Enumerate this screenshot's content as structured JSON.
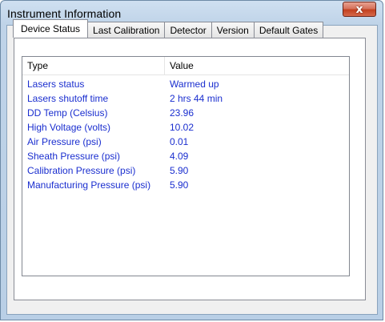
{
  "window": {
    "title": "Instrument Information",
    "close_glyph": "x"
  },
  "tabs": [
    {
      "label": "Device Status",
      "active": true
    },
    {
      "label": "Last Calibration",
      "active": false
    },
    {
      "label": "Detector",
      "active": false
    },
    {
      "label": "Version",
      "active": false
    },
    {
      "label": "Default Gates",
      "active": false
    }
  ],
  "list": {
    "columns": {
      "type": "Type",
      "value": "Value"
    },
    "row_color": "#1a2ecf",
    "rows": [
      {
        "type": "Lasers status",
        "value": "Warmed up"
      },
      {
        "type": "Lasers shutoff time",
        "value": "2 hrs 44 min"
      },
      {
        "type": "DD Temp (Celsius)",
        "value": "23.96"
      },
      {
        "type": "High Voltage (volts)",
        "value": "10.02"
      },
      {
        "type": "Air Pressure (psi)",
        "value": "0.01"
      },
      {
        "type": "Sheath Pressure (psi)",
        "value": "4.09"
      },
      {
        "type": "Calibration Pressure (psi)",
        "value": "5.90"
      },
      {
        "type": "Manufacturing Pressure (psi)",
        "value": "5.90"
      }
    ]
  }
}
